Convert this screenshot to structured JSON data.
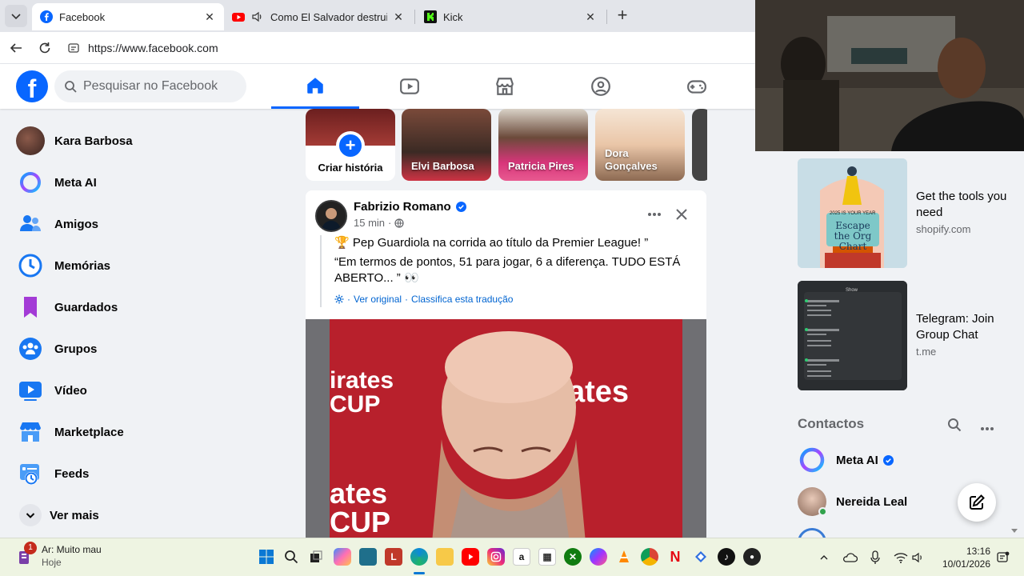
{
  "browser": {
    "tabs": [
      {
        "title": "Facebook",
        "icon": "facebook-icon",
        "active": true
      },
      {
        "title": "Como El Salvador destruiu su",
        "icon": "youtube-icon",
        "active": false
      },
      {
        "title": "Kick",
        "icon": "kick-icon",
        "active": false
      }
    ],
    "url": "https://www.facebook.com"
  },
  "header": {
    "logo": "f",
    "search_placeholder": "Pesquisar no Facebook",
    "nav": [
      "home-icon",
      "video-icon",
      "marketplace-icon",
      "groups-icon",
      "gaming-icon"
    ]
  },
  "sidebar": {
    "items": [
      {
        "label": "Kara Barbosa",
        "icon": "profile-avatar"
      },
      {
        "label": "Meta AI",
        "icon": "meta-ai-icon"
      },
      {
        "label": "Amigos",
        "icon": "friends-icon"
      },
      {
        "label": "Memórias",
        "icon": "memories-icon"
      },
      {
        "label": "Guardados",
        "icon": "saved-icon"
      },
      {
        "label": "Grupos",
        "icon": "groups-icon"
      },
      {
        "label": "Vídeo",
        "icon": "video-icon"
      },
      {
        "label": "Marketplace",
        "icon": "marketplace-icon"
      },
      {
        "label": "Feeds",
        "icon": "feeds-icon"
      },
      {
        "label": "Ver mais",
        "icon": "chevron-down-icon"
      }
    ]
  },
  "stories": [
    {
      "name": "Criar história"
    },
    {
      "name": "Elvi Barbosa"
    },
    {
      "name": "Patricia Pires"
    },
    {
      "name": "Dora Gonçalves"
    }
  ],
  "post": {
    "author": "Fabrizio Romano",
    "time": "15 min",
    "line1": "🏆 Pep Guardiola na corrida ao título da Premier League! ”",
    "line2": "“Em termos de pontos, 51 para jogar, 6 a diferença. TUDO ESTÁ ABERTO... ” 👀",
    "see_original": "Ver original",
    "rate_translation": "Classifica esta tradução",
    "image_text_top": "irates CUP",
    "image_text_right": "ates",
    "image_text_bottom": "ates CUP"
  },
  "ads": [
    {
      "title": "Get the tools you need",
      "domain": "shopify.com",
      "img_text_1": "2025 IS YOUR YEAR",
      "img_text_2": "Escape the Org Chart"
    },
    {
      "title": "Telegram: Join Group Chat",
      "domain": "t.me",
      "img_text_1": "Show"
    }
  ],
  "contacts": {
    "title": "Contactos",
    "items": [
      {
        "name": "Meta AI",
        "verified": true
      },
      {
        "name": "Nereida Leal",
        "online": true
      }
    ]
  },
  "taskbar": {
    "weather_title": "Ar: Muito mau",
    "weather_sub": "Hoje",
    "weather_badge": "1",
    "time": "13:16",
    "date": "10/01/2026"
  },
  "colors": {
    "brand": "#0866ff",
    "background": "#f0f2f5",
    "secondary_text": "#65676b"
  }
}
